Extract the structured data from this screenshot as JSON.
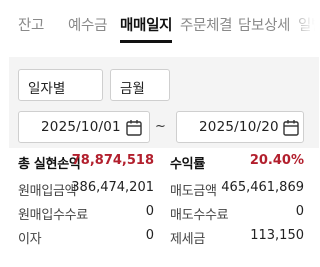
{
  "tabs": [
    {
      "label": "잔고",
      "active": false
    },
    {
      "label": "예수금",
      "active": false
    },
    {
      "label": "매매일지",
      "active": true
    },
    {
      "label": "주문체결",
      "active": false
    },
    {
      "label": "담보상세",
      "active": false
    },
    {
      "label": "일별",
      "active": false
    }
  ],
  "filters": {
    "type_select": "일자별",
    "unit_select": "금월",
    "start_date": "2025/10/01",
    "range_separator": "~",
    "end_date": "2025/10/20"
  },
  "summary": {
    "total_pnl_label": "총 실현손익",
    "total_pnl_value": "78,874,518",
    "return_label": "수익률",
    "return_value": "20.40%",
    "buy_amount_label": "원매입금액",
    "buy_amount_value": "386,474,201",
    "sell_amount_label": "매도금액",
    "sell_amount_value": "465,461,869",
    "buy_fee_label": "원매입수수료",
    "buy_fee_value": "0",
    "sell_fee_label": "매도수수료",
    "sell_fee_value": "0",
    "interest_label": "이자",
    "interest_value": "0",
    "tax_label": "제세금",
    "tax_value": "113,150"
  },
  "colors": {
    "accent_red": "#b21f2d",
    "inactive_tab": "#8a8a8a",
    "panel_bg": "#f4f4f4"
  }
}
